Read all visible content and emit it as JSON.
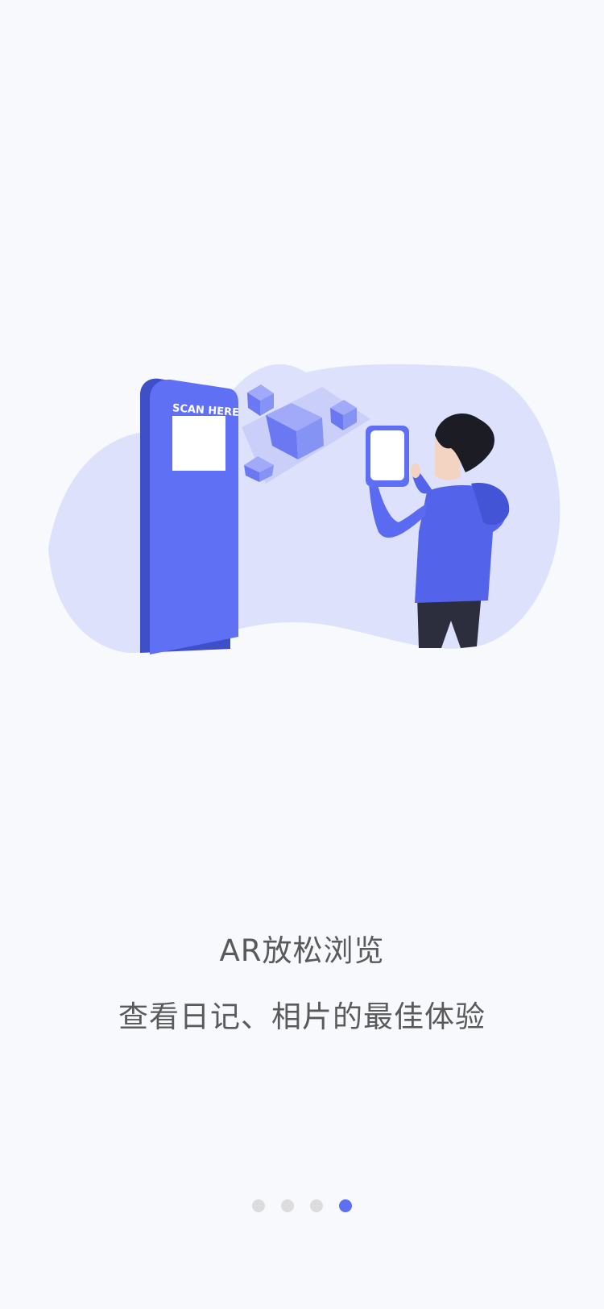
{
  "onboarding": {
    "title": "AR放松浏览",
    "subtitle": "查看日记、相片的最佳体验",
    "illustration": {
      "kiosk_label": "SCAN HERE",
      "icon": "ar-scan-illustration"
    },
    "pager": {
      "total": 4,
      "active_index": 3
    }
  },
  "colors": {
    "background": "#f7f9fd",
    "accent": "#5f6ff5",
    "blob": "#dde1fc",
    "text": "#5a5a5a",
    "dot_inactive": "#dcdcde"
  }
}
